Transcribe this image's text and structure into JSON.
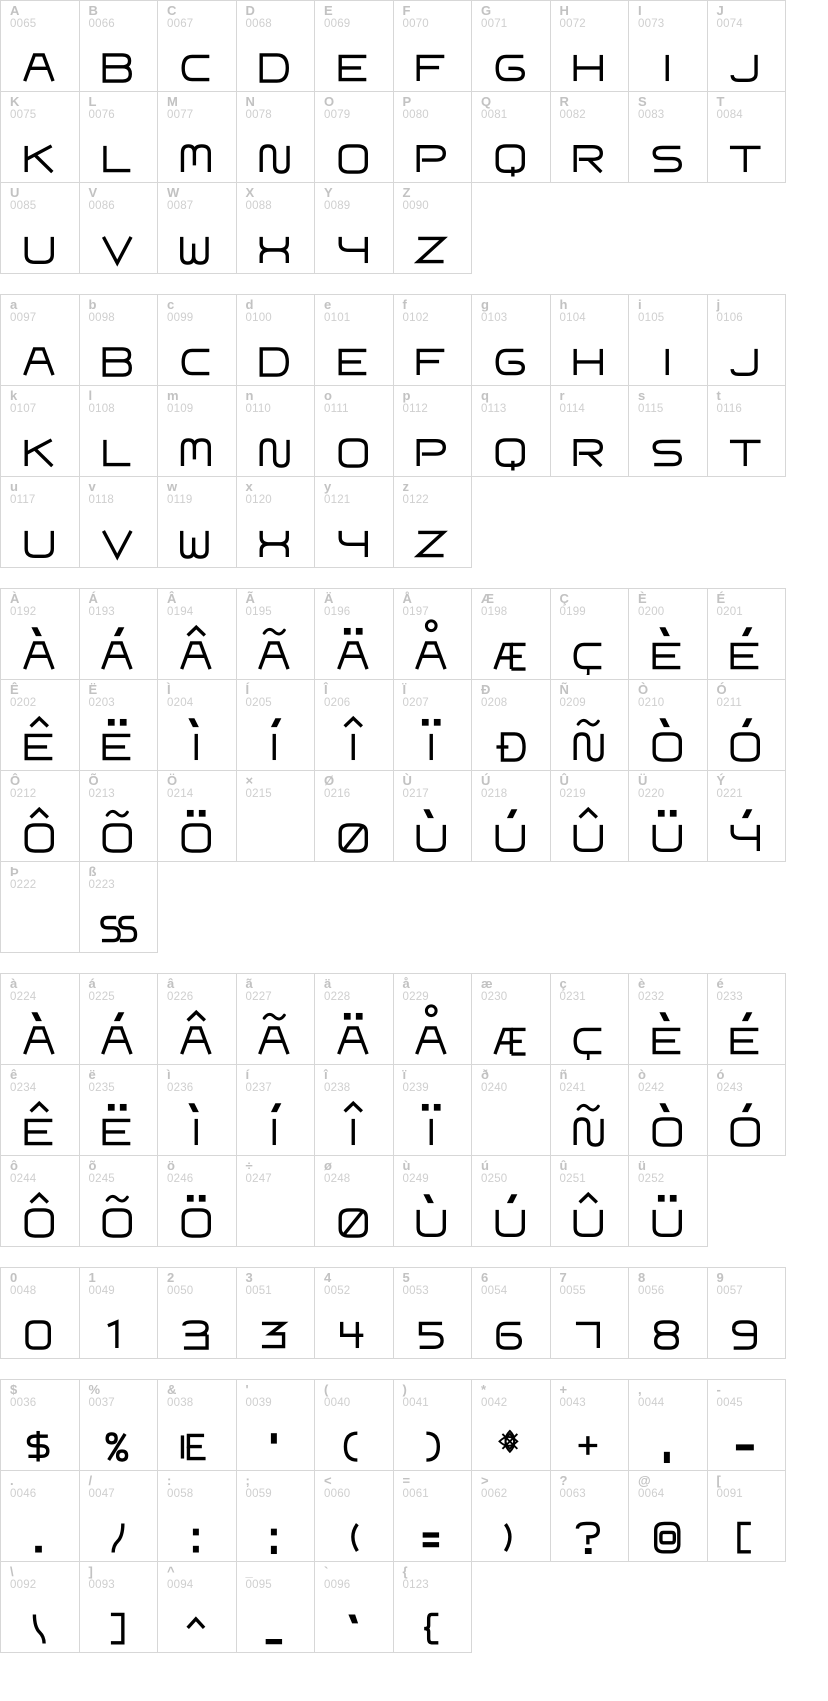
{
  "page": {
    "kind": "font-character-map",
    "columns_per_row": 10,
    "label_color": "#c2c2c2",
    "code_color": "#cfcfcf",
    "glyph_color": "#000000",
    "grid_line_color": "#d7d7d7",
    "background": "#ffffff"
  },
  "blocks": [
    {
      "name": "uppercase-latin",
      "cells": [
        {
          "ch": "A",
          "code": "0065",
          "glyph": "A"
        },
        {
          "ch": "B",
          "code": "0066",
          "glyph": "B"
        },
        {
          "ch": "C",
          "code": "0067",
          "glyph": "C"
        },
        {
          "ch": "D",
          "code": "0068",
          "glyph": "D"
        },
        {
          "ch": "E",
          "code": "0069",
          "glyph": "E"
        },
        {
          "ch": "F",
          "code": "0070",
          "glyph": "F"
        },
        {
          "ch": "G",
          "code": "0071",
          "glyph": "G"
        },
        {
          "ch": "H",
          "code": "0072",
          "glyph": "H"
        },
        {
          "ch": "I",
          "code": "0073",
          "glyph": "I"
        },
        {
          "ch": "J",
          "code": "0074",
          "glyph": "J"
        },
        {
          "ch": "K",
          "code": "0075",
          "glyph": "K"
        },
        {
          "ch": "L",
          "code": "0076",
          "glyph": "L"
        },
        {
          "ch": "M",
          "code": "0077",
          "glyph": "M"
        },
        {
          "ch": "N",
          "code": "0078",
          "glyph": "N"
        },
        {
          "ch": "O",
          "code": "0079",
          "glyph": "O"
        },
        {
          "ch": "P",
          "code": "0080",
          "glyph": "P"
        },
        {
          "ch": "Q",
          "code": "0081",
          "glyph": "Q"
        },
        {
          "ch": "R",
          "code": "0082",
          "glyph": "R"
        },
        {
          "ch": "S",
          "code": "0083",
          "glyph": "S"
        },
        {
          "ch": "T",
          "code": "0084",
          "glyph": "T"
        },
        {
          "ch": "U",
          "code": "0085",
          "glyph": "U"
        },
        {
          "ch": "V",
          "code": "0086",
          "glyph": "V"
        },
        {
          "ch": "W",
          "code": "0087",
          "glyph": "W"
        },
        {
          "ch": "X",
          "code": "0088",
          "glyph": "X"
        },
        {
          "ch": "Y",
          "code": "0089",
          "glyph": "Y"
        },
        {
          "ch": "Z",
          "code": "0090",
          "glyph": "Z"
        }
      ]
    },
    {
      "name": "lowercase-latin",
      "cells": [
        {
          "ch": "a",
          "code": "0097",
          "glyph": "a"
        },
        {
          "ch": "b",
          "code": "0098",
          "glyph": "b"
        },
        {
          "ch": "c",
          "code": "0099",
          "glyph": "c"
        },
        {
          "ch": "d",
          "code": "0100",
          "glyph": "d"
        },
        {
          "ch": "e",
          "code": "0101",
          "glyph": "e"
        },
        {
          "ch": "f",
          "code": "0102",
          "glyph": "f"
        },
        {
          "ch": "g",
          "code": "0103",
          "glyph": "g"
        },
        {
          "ch": "h",
          "code": "0104",
          "glyph": "h"
        },
        {
          "ch": "i",
          "code": "0105",
          "glyph": "i"
        },
        {
          "ch": "j",
          "code": "0106",
          "glyph": "j"
        },
        {
          "ch": "k",
          "code": "0107",
          "glyph": "k"
        },
        {
          "ch": "l",
          "code": "0108",
          "glyph": "l"
        },
        {
          "ch": "m",
          "code": "0109",
          "glyph": "m"
        },
        {
          "ch": "n",
          "code": "0110",
          "glyph": "n"
        },
        {
          "ch": "o",
          "code": "0111",
          "glyph": "o"
        },
        {
          "ch": "p",
          "code": "0112",
          "glyph": "p"
        },
        {
          "ch": "q",
          "code": "0113",
          "glyph": "q"
        },
        {
          "ch": "r",
          "code": "0114",
          "glyph": "r"
        },
        {
          "ch": "s",
          "code": "0115",
          "glyph": "s"
        },
        {
          "ch": "t",
          "code": "0116",
          "glyph": "t"
        },
        {
          "ch": "u",
          "code": "0117",
          "glyph": "u"
        },
        {
          "ch": "v",
          "code": "0118",
          "glyph": "v"
        },
        {
          "ch": "w",
          "code": "0119",
          "glyph": "w"
        },
        {
          "ch": "x",
          "code": "0120",
          "glyph": "x"
        },
        {
          "ch": "y",
          "code": "0121",
          "glyph": "y"
        },
        {
          "ch": "z",
          "code": "0122",
          "glyph": "z"
        }
      ]
    },
    {
      "name": "uppercase-accented",
      "cells": [
        {
          "ch": "À",
          "code": "0192",
          "glyph": "A",
          "accent": "grave"
        },
        {
          "ch": "Á",
          "code": "0193",
          "glyph": "A",
          "accent": "acute"
        },
        {
          "ch": "Â",
          "code": "0194",
          "glyph": "A",
          "accent": "circumflex"
        },
        {
          "ch": "Ã",
          "code": "0195",
          "glyph": "A",
          "accent": "tilde"
        },
        {
          "ch": "Ä",
          "code": "0196",
          "glyph": "A",
          "accent": "diaeresis"
        },
        {
          "ch": "Å",
          "code": "0197",
          "glyph": "A",
          "accent": "ring"
        },
        {
          "ch": "Æ",
          "code": "0198",
          "glyph": "AE"
        },
        {
          "ch": "Ç",
          "code": "0199",
          "glyph": "C",
          "accent": "cedilla"
        },
        {
          "ch": "È",
          "code": "0200",
          "glyph": "E",
          "accent": "grave"
        },
        {
          "ch": "É",
          "code": "0201",
          "glyph": "E",
          "accent": "acute"
        },
        {
          "ch": "Ê",
          "code": "0202",
          "glyph": "E",
          "accent": "circumflex"
        },
        {
          "ch": "Ë",
          "code": "0203",
          "glyph": "E",
          "accent": "diaeresis"
        },
        {
          "ch": "Ì",
          "code": "0204",
          "glyph": "I",
          "accent": "grave"
        },
        {
          "ch": "Í",
          "code": "0205",
          "glyph": "I",
          "accent": "acute"
        },
        {
          "ch": "Î",
          "code": "0206",
          "glyph": "I",
          "accent": "circumflex"
        },
        {
          "ch": "Ï",
          "code": "0207",
          "glyph": "I",
          "accent": "diaeresis"
        },
        {
          "ch": "Ð",
          "code": "0208",
          "glyph": "Eth"
        },
        {
          "ch": "Ñ",
          "code": "0209",
          "glyph": "N",
          "accent": "tilde"
        },
        {
          "ch": "Ò",
          "code": "0210",
          "glyph": "O",
          "accent": "grave"
        },
        {
          "ch": "Ó",
          "code": "0211",
          "glyph": "O",
          "accent": "acute"
        },
        {
          "ch": "Ô",
          "code": "0212",
          "glyph": "O",
          "accent": "circumflex"
        },
        {
          "ch": "Õ",
          "code": "0213",
          "glyph": "O",
          "accent": "tilde"
        },
        {
          "ch": "Ö",
          "code": "0214",
          "glyph": "O",
          "accent": "diaeresis"
        },
        {
          "ch": "×",
          "code": "0215",
          "glyph": ""
        },
        {
          "ch": "Ø",
          "code": "0216",
          "glyph": "Oslash"
        },
        {
          "ch": "Ù",
          "code": "0217",
          "glyph": "U",
          "accent": "grave"
        },
        {
          "ch": "Ú",
          "code": "0218",
          "glyph": "U",
          "accent": "acute"
        },
        {
          "ch": "Û",
          "code": "0219",
          "glyph": "U",
          "accent": "circumflex"
        },
        {
          "ch": "Ü",
          "code": "0220",
          "glyph": "U",
          "accent": "diaeresis"
        },
        {
          "ch": "Ý",
          "code": "0221",
          "glyph": "Y",
          "accent": "acute"
        },
        {
          "ch": "Þ",
          "code": "0222",
          "glyph": ""
        },
        {
          "ch": "ß",
          "code": "0223",
          "glyph": "SS"
        }
      ]
    },
    {
      "name": "lowercase-accented",
      "cells": [
        {
          "ch": "à",
          "code": "0224",
          "glyph": "a",
          "accent": "grave"
        },
        {
          "ch": "á",
          "code": "0225",
          "glyph": "a",
          "accent": "acute"
        },
        {
          "ch": "â",
          "code": "0226",
          "glyph": "a",
          "accent": "circumflex"
        },
        {
          "ch": "ã",
          "code": "0227",
          "glyph": "a",
          "accent": "tilde"
        },
        {
          "ch": "ä",
          "code": "0228",
          "glyph": "a",
          "accent": "diaeresis"
        },
        {
          "ch": "å",
          "code": "0229",
          "glyph": "a",
          "accent": "ring"
        },
        {
          "ch": "æ",
          "code": "0230",
          "glyph": "ae"
        },
        {
          "ch": "ç",
          "code": "0231",
          "glyph": "c",
          "accent": "cedilla"
        },
        {
          "ch": "è",
          "code": "0232",
          "glyph": "e",
          "accent": "grave"
        },
        {
          "ch": "é",
          "code": "0233",
          "glyph": "e",
          "accent": "acute"
        },
        {
          "ch": "ê",
          "code": "0234",
          "glyph": "e",
          "accent": "circumflex"
        },
        {
          "ch": "ë",
          "code": "0235",
          "glyph": "e",
          "accent": "diaeresis"
        },
        {
          "ch": "ì",
          "code": "0236",
          "glyph": "i",
          "accent": "grave"
        },
        {
          "ch": "í",
          "code": "0237",
          "glyph": "i",
          "accent": "acute"
        },
        {
          "ch": "î",
          "code": "0238",
          "glyph": "i",
          "accent": "circumflex"
        },
        {
          "ch": "ï",
          "code": "0239",
          "glyph": "i",
          "accent": "diaeresis"
        },
        {
          "ch": "ð",
          "code": "0240",
          "glyph": ""
        },
        {
          "ch": "ñ",
          "code": "0241",
          "glyph": "n",
          "accent": "tilde"
        },
        {
          "ch": "ò",
          "code": "0242",
          "glyph": "o",
          "accent": "grave"
        },
        {
          "ch": "ó",
          "code": "0243",
          "glyph": "o",
          "accent": "acute"
        },
        {
          "ch": "ô",
          "code": "0244",
          "glyph": "o",
          "accent": "circumflex"
        },
        {
          "ch": "õ",
          "code": "0245",
          "glyph": "o",
          "accent": "tilde"
        },
        {
          "ch": "ö",
          "code": "0246",
          "glyph": "o",
          "accent": "diaeresis"
        },
        {
          "ch": "÷",
          "code": "0247",
          "glyph": ""
        },
        {
          "ch": "ø",
          "code": "0248",
          "glyph": "oslash"
        },
        {
          "ch": "ù",
          "code": "0249",
          "glyph": "u",
          "accent": "grave"
        },
        {
          "ch": "ú",
          "code": "0250",
          "glyph": "u",
          "accent": "acute"
        },
        {
          "ch": "û",
          "code": "0251",
          "glyph": "u",
          "accent": "circumflex"
        },
        {
          "ch": "ü",
          "code": "0252",
          "glyph": "u",
          "accent": "diaeresis"
        }
      ]
    },
    {
      "name": "digits",
      "cells": [
        {
          "ch": "0",
          "code": "0048",
          "glyph": "0"
        },
        {
          "ch": "1",
          "code": "0049",
          "glyph": "1"
        },
        {
          "ch": "2",
          "code": "0050",
          "glyph": "2"
        },
        {
          "ch": "3",
          "code": "0051",
          "glyph": "3"
        },
        {
          "ch": "4",
          "code": "0052",
          "glyph": "4"
        },
        {
          "ch": "5",
          "code": "0053",
          "glyph": "5"
        },
        {
          "ch": "6",
          "code": "0054",
          "glyph": "6"
        },
        {
          "ch": "7",
          "code": "0055",
          "glyph": "7"
        },
        {
          "ch": "8",
          "code": "0056",
          "glyph": "8"
        },
        {
          "ch": "9",
          "code": "0057",
          "glyph": "9"
        }
      ]
    },
    {
      "name": "punctuation-symbols",
      "cells": [
        {
          "ch": "$",
          "code": "0036",
          "glyph": "dollar"
        },
        {
          "ch": "%",
          "code": "0037",
          "glyph": "percent"
        },
        {
          "ch": "&",
          "code": "0038",
          "glyph": "ampersand"
        },
        {
          "ch": "'",
          "code": "0039",
          "glyph": "quotesingle"
        },
        {
          "ch": "(",
          "code": "0040",
          "glyph": "parenleft"
        },
        {
          "ch": ")",
          "code": "0041",
          "glyph": "parenright"
        },
        {
          "ch": "*",
          "code": "0042",
          "glyph": "asterisk"
        },
        {
          "ch": "+",
          "code": "0043",
          "glyph": "plus"
        },
        {
          "ch": ",",
          "code": "0044",
          "glyph": "comma"
        },
        {
          "ch": "-",
          "code": "0045",
          "glyph": "hyphen"
        },
        {
          "ch": ".",
          "code": "0046",
          "glyph": "period"
        },
        {
          "ch": "/",
          "code": "0047",
          "glyph": "slash"
        },
        {
          "ch": ":",
          "code": "0058",
          "glyph": "colon"
        },
        {
          "ch": ";",
          "code": "0059",
          "glyph": "semicolon"
        },
        {
          "ch": "<",
          "code": "0060",
          "glyph": "less"
        },
        {
          "ch": "=",
          "code": "0061",
          "glyph": "equal"
        },
        {
          "ch": ">",
          "code": "0062",
          "glyph": "greater"
        },
        {
          "ch": "?",
          "code": "0063",
          "glyph": "question"
        },
        {
          "ch": "@",
          "code": "0064",
          "glyph": "at"
        },
        {
          "ch": "[",
          "code": "0091",
          "glyph": "bracketleft"
        },
        {
          "ch": "\\",
          "code": "0092",
          "glyph": "backslash"
        },
        {
          "ch": "]",
          "code": "0093",
          "glyph": "bracketright"
        },
        {
          "ch": "^",
          "code": "0094",
          "glyph": "asciicircum"
        },
        {
          "ch": "_",
          "code": "0095",
          "glyph": "underscore"
        },
        {
          "ch": "`",
          "code": "0096",
          "glyph": "grave"
        },
        {
          "ch": "{",
          "code": "0123",
          "glyph": "braceleft"
        }
      ]
    }
  ]
}
